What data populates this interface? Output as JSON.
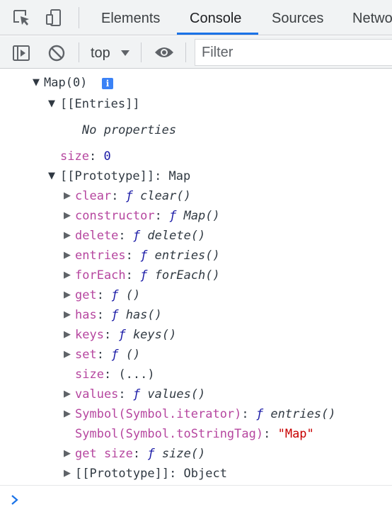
{
  "tabs": {
    "items": [
      "Elements",
      "Console",
      "Sources",
      "Network"
    ],
    "active": "Console"
  },
  "toolbar": {
    "context": "top",
    "filter_placeholder": "Filter"
  },
  "console": {
    "root_label": "Map(0)",
    "entries_label": "[[Entries]]",
    "no_properties": "No properties",
    "size_key": "size",
    "size_value": "0",
    "prototype_label": "[[Prototype]]",
    "prototype_value": "Map",
    "f": "ƒ",
    "members": [
      {
        "key": "clear",
        "fn": "clear()"
      },
      {
        "key": "constructor",
        "fn": "Map()"
      },
      {
        "key": "delete",
        "fn": "delete()"
      },
      {
        "key": "entries",
        "fn": "entries()"
      },
      {
        "key": "forEach",
        "fn": "forEach()"
      },
      {
        "key": "get",
        "fn": "()"
      },
      {
        "key": "has",
        "fn": "has()"
      },
      {
        "key": "keys",
        "fn": "keys()"
      },
      {
        "key": "set",
        "fn": "()"
      }
    ],
    "size_getter_key": "size",
    "size_getter_value": "(...)",
    "values_key": "values",
    "values_fn": "values()",
    "iterator_key": "Symbol(Symbol.iterator)",
    "iterator_fn": "entries()",
    "tostringtag_key": "Symbol(Symbol.toStringTag)",
    "tostringtag_value": "\"Map\"",
    "get_size_key": "get size",
    "get_size_fn": "size()",
    "object_proto_label": "[[Prototype]]",
    "object_proto_value": "Object"
  },
  "colors": {
    "accent": "#1a73e8",
    "property_key": "#b6469f",
    "function_f": "#1a1aa6",
    "string": "#c80000"
  },
  "icons": [
    "inspect-element-icon",
    "device-toolbar-icon",
    "sidebar-toggle-icon",
    "clear-console-icon",
    "caret-down-icon",
    "eye-icon",
    "info-icon",
    "prompt-chevron-icon"
  ]
}
